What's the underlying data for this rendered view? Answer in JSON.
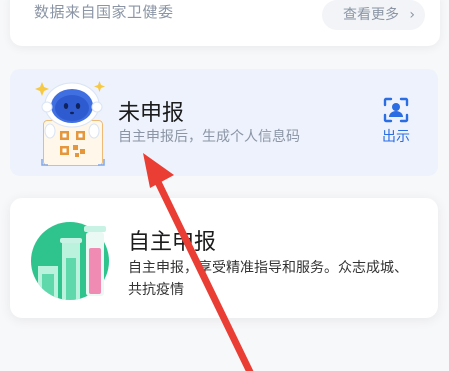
{
  "top_card": {
    "source_text": "数据来自国家卫健委",
    "view_more_label": "查看更多",
    "view_more_icon": "chevron-right-icon"
  },
  "unreported_card": {
    "title": "未申报",
    "subtitle": "自主申报后，生成个人信息码",
    "show_label": "出示",
    "show_icon": "face-scan-icon",
    "mascot_icon": "mascot-qr-icon",
    "accent_color": "#2b6de3",
    "background_color": "#edf2fc"
  },
  "self_report_card": {
    "title": "自主申报",
    "description": "自主申报，享受精准指导和服务。众志成城、共抗疫情",
    "illustration_icon": "test-tube-icon",
    "illustration_color": "#2fc38d"
  },
  "annotation": {
    "type": "red-arrow",
    "color": "#ea3d34"
  }
}
